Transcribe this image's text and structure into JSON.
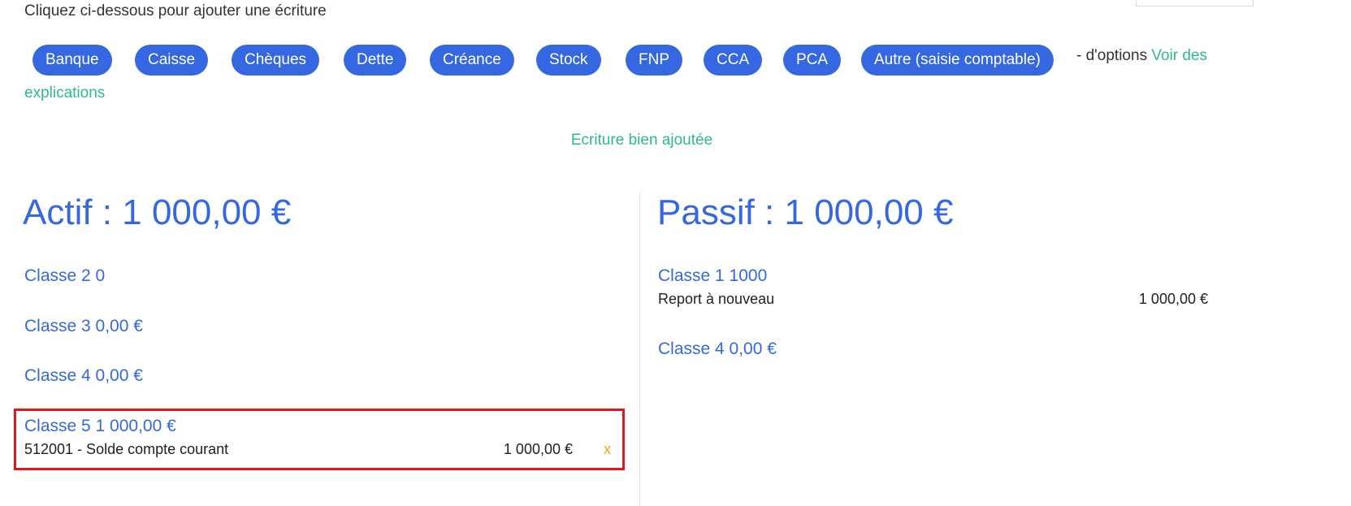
{
  "header": {
    "instruction": "Cliquez ci-dessous pour ajouter une écriture"
  },
  "entry_buttons": [
    {
      "label": "Banque"
    },
    {
      "label": "Caisse"
    },
    {
      "label": "Chèques"
    },
    {
      "label": "Dette"
    },
    {
      "label": "Créance"
    },
    {
      "label": "Stock"
    },
    {
      "label": "FNP"
    },
    {
      "label": "CCA"
    },
    {
      "label": "PCA"
    },
    {
      "label": "Autre (saisie comptable)"
    }
  ],
  "options": {
    "text": "- d'options",
    "link_part1": "Voir des",
    "link_part2": "explications"
  },
  "status": {
    "message": "Ecriture bien ajoutée"
  },
  "actif": {
    "title": "Actif : 1 000,00 €",
    "classes": [
      {
        "label": "Classe 2 0"
      },
      {
        "label": "Classe 3 0,00 €"
      },
      {
        "label": "Classe 4 0,00 €"
      },
      {
        "label": "Classe 5 1 000,00 €",
        "account": "512001 - Solde compte courant",
        "amount": "1 000,00 €",
        "delete": "x"
      }
    ]
  },
  "passif": {
    "title": "Passif : 1 000,00 €",
    "classes": [
      {
        "label": "Classe 1 1000",
        "account": "Report à nouveau",
        "amount": "1 000,00 €"
      },
      {
        "label": "Classe 4 0,00 €"
      }
    ]
  },
  "colors": {
    "primary_blue": "#3568e0",
    "link_green": "#2fb890",
    "delete_orange": "#f2a61c",
    "highlight_red": "#e8141b"
  }
}
